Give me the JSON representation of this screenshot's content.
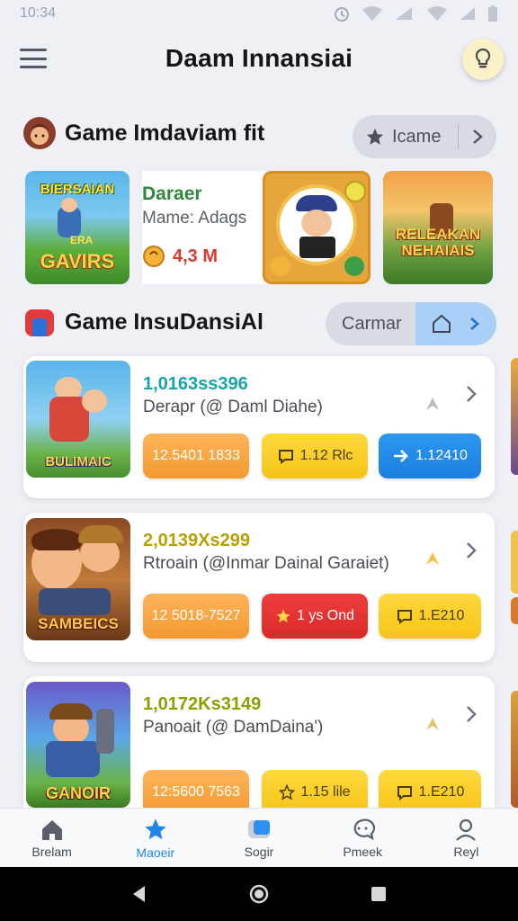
{
  "status_bar": {
    "time": "10:34"
  },
  "header": {
    "title": "Daam Innansiai"
  },
  "section1": {
    "title": "Game Imdaviam fit",
    "pill_label": "Icame"
  },
  "featured": {
    "thumb1_top": "BIERSAIAN",
    "thumb1_bottom": "GAVIRS",
    "thumb1_small": "ERA",
    "info_title": "Daraer",
    "info_sub": "Mame: Adags",
    "info_price": "4,3 M",
    "thumb3_text": "RELEAKAN NEHAIAIS"
  },
  "section2": {
    "title": "Game InsuDansiAl",
    "pill_label": "Carmar"
  },
  "games": [
    {
      "title": "1,0163ss396",
      "title_color": "#17a3a8",
      "subtitle": "Derapr (@ Daml Diahe)",
      "thumb_text": "BULIMAIC",
      "buttons": [
        {
          "label": "12.5401 1833",
          "style": "orange",
          "icon": ""
        },
        {
          "label": "1.12 Rlc",
          "style": "yellow",
          "icon": "chat"
        },
        {
          "label": "1.12410",
          "style": "blue",
          "icon": "arrow"
        }
      ]
    },
    {
      "title": "2,0139Xs299",
      "title_color": "#b6a100",
      "subtitle": "Rtroain (@Inmar Dainal Garaiet)",
      "thumb_text": "SAMBEICS",
      "buttons": [
        {
          "label": "12 5018-7527",
          "style": "orange",
          "icon": ""
        },
        {
          "label": "1 ys Ond",
          "style": "red",
          "icon": "star"
        },
        {
          "label": "1.E210",
          "style": "yellow",
          "icon": "chat"
        }
      ]
    },
    {
      "title": "1,0172Ks3149",
      "title_color": "#8aa100",
      "subtitle": "Panoait (@ DamDaina')",
      "thumb_text": "GANOIR",
      "buttons": [
        {
          "label": "12:5600 7563",
          "style": "orange",
          "icon": ""
        },
        {
          "label": "1.15 lile",
          "style": "yellow",
          "icon": "star"
        },
        {
          "label": "1.E210",
          "style": "yellow",
          "icon": "chat"
        }
      ]
    }
  ],
  "bottom_nav": [
    {
      "label": "Brelam",
      "icon": "home-icon",
      "active": false
    },
    {
      "label": "Maoeir",
      "icon": "star-icon",
      "active": true
    },
    {
      "label": "Sogir",
      "icon": "square-icon",
      "active": false
    },
    {
      "label": "Pmeek",
      "icon": "chat-icon",
      "active": false
    },
    {
      "label": "Reyl",
      "icon": "person-icon",
      "active": false
    }
  ],
  "colors": {
    "accent": "#1f86e8",
    "background": "#eef0f6",
    "orange": "#f29a30",
    "yellow": "#f6c417",
    "red": "#d92a2a"
  }
}
